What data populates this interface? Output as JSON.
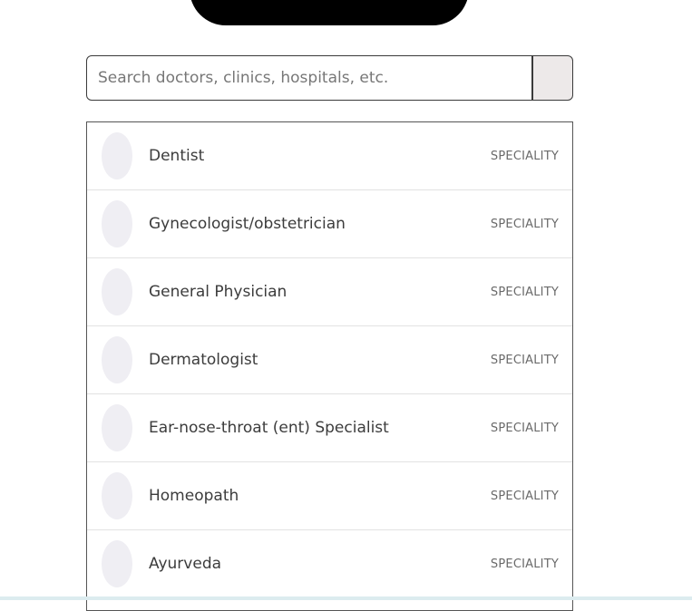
{
  "search": {
    "placeholder": "Search doctors, clinics, hospitals, etc.",
    "value": ""
  },
  "results": [
    {
      "name": "Dentist",
      "type": "SPECIALITY"
    },
    {
      "name": "Gynecologist/obstetrician",
      "type": "SPECIALITY"
    },
    {
      "name": "General Physician",
      "type": "SPECIALITY"
    },
    {
      "name": "Dermatologist",
      "type": "SPECIALITY"
    },
    {
      "name": "Ear-nose-throat (ent) Specialist",
      "type": "SPECIALITY"
    },
    {
      "name": "Homeopath",
      "type": "SPECIALITY"
    },
    {
      "name": "Ayurveda",
      "type": "SPECIALITY"
    }
  ],
  "colors": {
    "banner": "#000000",
    "search_button_bg": "#ede9e9",
    "avatar_bg": "#efeef3"
  }
}
